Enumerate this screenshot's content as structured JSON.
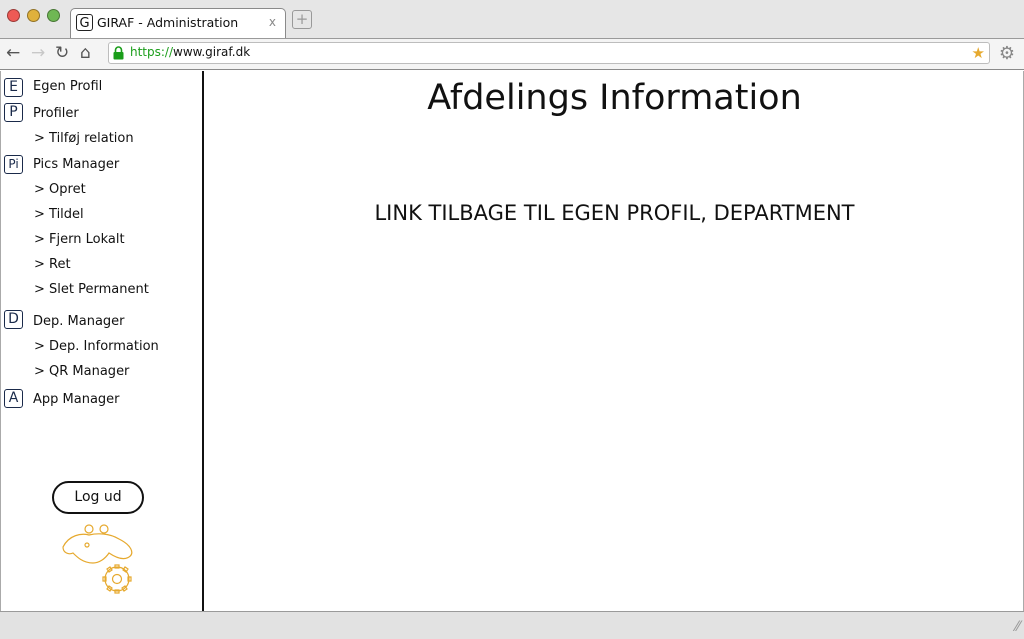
{
  "browser": {
    "tab_icon_letter": "G",
    "tab_title": "GIRAF - Administration",
    "tab_close": "x",
    "new_tab_symbol": "+",
    "url_scheme": "https://",
    "url_host": "www.giraf.dk",
    "back_icon": "←",
    "forward_icon": "→",
    "reload_icon": "↻",
    "home_icon": "⌂",
    "star_icon": "★",
    "settings_icon": "⚙"
  },
  "sidebar": {
    "egen_profil": {
      "icon": "E",
      "label": "Egen Profil"
    },
    "profiler": {
      "icon": "P",
      "label": "Profiler",
      "subitems": [
        "> Tilføj relation"
      ]
    },
    "pics_manager": {
      "icon": "Pi",
      "label": "Pics Manager",
      "subitems": [
        "> Opret",
        "> Tildel",
        "> Fjern Lokalt",
        "> Ret",
        "> Slet Permanent"
      ]
    },
    "dep_manager": {
      "icon": "D",
      "label": "Dep. Manager",
      "subitems": [
        "> Dep. Information",
        "> QR Manager"
      ]
    },
    "app_manager": {
      "icon": "A",
      "label": "App Manager"
    },
    "logout_label": "Log ud"
  },
  "main": {
    "title": "Afdelings Information",
    "link_text": "LINK TILBAGE TIL EGEN PROFIL, DEPARTMENT"
  },
  "colors": {
    "url_scheme": "#1a9d1a",
    "logo": "#e6a92e"
  }
}
